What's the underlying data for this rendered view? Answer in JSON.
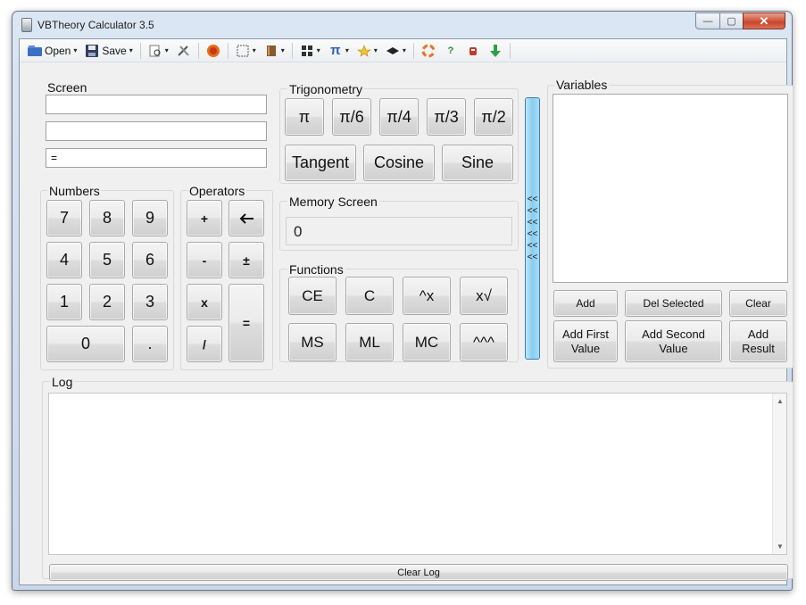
{
  "window": {
    "title": "VBTheory Calculator 3.5",
    "min": "—",
    "max": "▢",
    "close": "✕"
  },
  "toolbar": {
    "open_label": "Open",
    "save_label": "Save",
    "caret": "▾",
    "icons": [
      "open-icon",
      "save-icon",
      "preview-icon",
      "tools-icon",
      "firefox-icon",
      "frame-icon",
      "book-icon",
      "grid-icon",
      "pi-icon",
      "star-icon",
      "hat-icon",
      "lifebuoy-icon",
      "help-icon",
      "bug-icon",
      "download-icon"
    ],
    "pi_glyph": "π",
    "help_glyph": "?"
  },
  "screen": {
    "title": "Screen",
    "line1": "",
    "line2": "",
    "line3": "="
  },
  "numbers": {
    "title": "Numbers",
    "keys": [
      "7",
      "8",
      "9",
      "4",
      "5",
      "6",
      "1",
      "2",
      "3",
      "0",
      "."
    ]
  },
  "operators": {
    "title": "Operators",
    "plus": "+",
    "back": "🡐",
    "minus": "-",
    "plusminus": "±",
    "times": "x",
    "equals": "=",
    "divide": "/"
  },
  "trig": {
    "title": "Trigonometry",
    "keys": [
      "π",
      "π/6",
      "π/4",
      "π/3",
      "π/2"
    ],
    "tangent": "Tangent",
    "cosine": "Cosine",
    "sine": "Sine"
  },
  "memory": {
    "title": "Memory Screen",
    "value": "0"
  },
  "functions": {
    "title": "Functions",
    "keys": [
      "CE",
      "C",
      "^x",
      "x√",
      "MS",
      "ML",
      "MC",
      "^^^"
    ]
  },
  "divider": {
    "arrows": [
      "<<",
      "<<",
      "<<",
      "<<",
      "<<",
      "<<"
    ]
  },
  "variables": {
    "title": "Variables",
    "add": "Add",
    "del_selected": "Del Selected",
    "clear": "Clear",
    "add_first": "Add First Value",
    "add_second": "Add Second Value",
    "add_result": "Add Result"
  },
  "log": {
    "title": "Log",
    "content": "",
    "clear": "Clear Log",
    "up": "▲",
    "down": "▼"
  },
  "colors": {
    "accent_divider": "#87cdf0",
    "close_button": "#c9462c"
  }
}
